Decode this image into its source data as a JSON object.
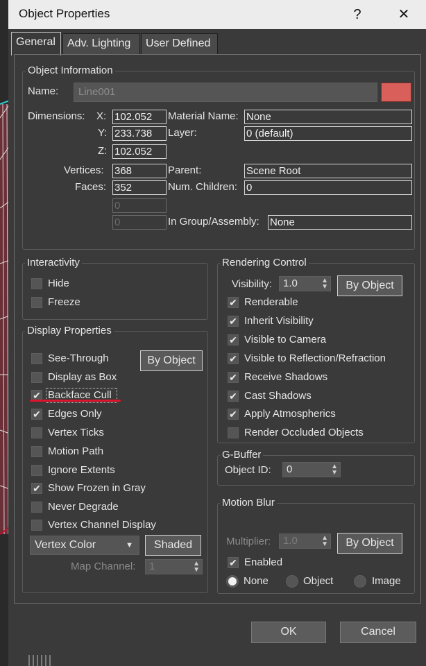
{
  "title": "Object Properties",
  "title_buttons": {
    "help": "?",
    "close": "✕"
  },
  "tabs": [
    {
      "label": "General",
      "active": true
    },
    {
      "label": "Adv. Lighting",
      "active": false
    },
    {
      "label": "User Defined",
      "active": false
    }
  ],
  "object_info": {
    "legend": "Object Information",
    "name_label": "Name:",
    "name_value": "Line001",
    "color": "#d9605a",
    "dimensions_label": "Dimensions:",
    "x_label": "X:",
    "x_value": "102.052",
    "y_label": "Y:",
    "y_value": "233.738",
    "z_label": "Z:",
    "z_value": "102.052",
    "vertices_label": "Vertices:",
    "vertices_value": "368",
    "faces_label": "Faces:",
    "faces_value": "352",
    "extra1_value": "0",
    "extra2_value": "0",
    "material_label": "Material Name:",
    "material_value": "None",
    "layer_label": "Layer:",
    "layer_value": "0 (default)",
    "parent_label": "Parent:",
    "parent_value": "Scene Root",
    "children_label": "Num. Children:",
    "children_value": "0",
    "group_label": "In Group/Assembly:",
    "group_value": "None"
  },
  "interactivity": {
    "legend": "Interactivity",
    "hide": {
      "label": "Hide",
      "checked": false
    },
    "freeze": {
      "label": "Freeze",
      "checked": false
    }
  },
  "display": {
    "legend": "Display Properties",
    "by_object_label": "By Object",
    "items": [
      {
        "label": "See-Through",
        "checked": false
      },
      {
        "label": "Display as Box",
        "checked": false
      },
      {
        "label": "Backface Cull",
        "checked": true
      },
      {
        "label": "Edges Only",
        "checked": true
      },
      {
        "label": "Vertex Ticks",
        "checked": false
      },
      {
        "label": "Motion Path",
        "checked": false
      },
      {
        "label": "Ignore Extents",
        "checked": false
      },
      {
        "label": "Show Frozen in Gray",
        "checked": true
      },
      {
        "label": "Never Degrade",
        "checked": false
      },
      {
        "label": "Vertex Channel Display",
        "checked": false
      }
    ],
    "vertex_color_dropdown": "Vertex Color",
    "shaded_label": "Shaded",
    "map_channel_label": "Map Channel:",
    "map_channel_value": "1"
  },
  "rendering": {
    "legend": "Rendering Control",
    "visibility_label": "Visibility:",
    "visibility_value": "1.0",
    "by_object_label": "By Object",
    "items": [
      {
        "label": "Renderable",
        "checked": true
      },
      {
        "label": "Inherit Visibility",
        "checked": true
      },
      {
        "label": "Visible to Camera",
        "checked": true
      },
      {
        "label": "Visible to Reflection/Refraction",
        "checked": true
      },
      {
        "label": "Receive Shadows",
        "checked": true
      },
      {
        "label": "Cast Shadows",
        "checked": true
      },
      {
        "label": "Apply Atmospherics",
        "checked": true
      },
      {
        "label": "Render Occluded Objects",
        "checked": false
      }
    ]
  },
  "gbuffer": {
    "legend": "G-Buffer",
    "object_id_label": "Object ID:",
    "object_id_value": "0"
  },
  "motion_blur": {
    "legend": "Motion Blur",
    "multiplier_label": "Multiplier:",
    "multiplier_value": "1.0",
    "by_object_label": "By Object",
    "enabled_label": "Enabled",
    "enabled_checked": true,
    "radios": [
      {
        "label": "None",
        "selected": true
      },
      {
        "label": "Object",
        "selected": false
      },
      {
        "label": "Image",
        "selected": false
      }
    ]
  },
  "footer": {
    "ok": "OK",
    "cancel": "Cancel"
  },
  "colors": {
    "accent_red": "#e0132c",
    "dialog_bg": "#3a3a3a",
    "titlebar_bg": "#ececec"
  }
}
